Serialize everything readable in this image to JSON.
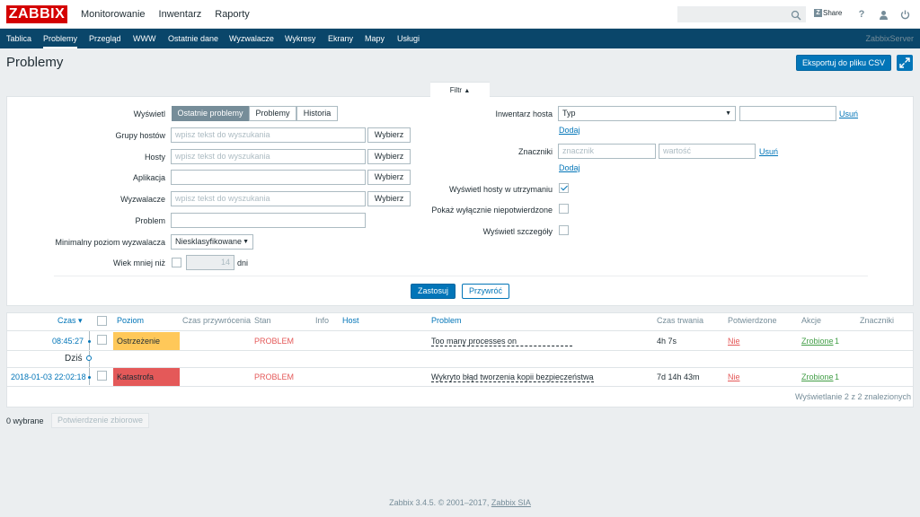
{
  "header": {
    "logo": "ZABBIX",
    "menu": [
      "Monitorowanie",
      "Inwentarz",
      "Raporty"
    ],
    "search_placeholder": "",
    "share": "Share",
    "help": "?"
  },
  "nav": {
    "items": [
      "Tablica",
      "Problemy",
      "Przegląd",
      "WWW",
      "Ostatnie dane",
      "Wyzwalacze",
      "Wykresy",
      "Ekrany",
      "Mapy",
      "Usługi"
    ],
    "active": "Problemy",
    "server": "ZabbixServer"
  },
  "page": {
    "title": "Problemy",
    "export_button": "Eksportuj do pliku CSV"
  },
  "filter": {
    "tab_label": "Filtr",
    "show_label": "Wyświetl",
    "show_options": [
      "Ostatnie problemy",
      "Problemy",
      "Historia"
    ],
    "show_selected": "Ostatnie problemy",
    "host_groups_label": "Grupy hostów",
    "hosts_label": "Hosty",
    "application_label": "Aplikacja",
    "triggers_label": "Wyzwalacze",
    "problem_label": "Problem",
    "min_severity_label": "Minimalny poziom wyzwalacza",
    "min_severity_value": "Niesklasyfikowane",
    "age_label": "Wiek mniej niż",
    "age_value": "14",
    "age_unit": "dni",
    "placeholder": "wpisz tekst do wyszukania",
    "select_button": "Wybierz",
    "inventory_label": "Inwentarz hosta",
    "inventory_field": "Typ",
    "remove_link": "Usuń",
    "add_link": "Dodaj",
    "tags_label": "Znaczniki",
    "tag_placeholder": "znacznik",
    "value_placeholder": "wartość",
    "maintenance_label": "Wyświetl hosty w utrzymaniu",
    "maintenance_checked": true,
    "unack_label": "Pokaż wyłącznie niepotwierdzone",
    "unack_checked": false,
    "details_label": "Wyświetl szczegóły",
    "details_checked": false,
    "apply_button": "Zastosuj",
    "reset_button": "Przywróć"
  },
  "table": {
    "headers": {
      "time": "Czas ▾",
      "severity": "Poziom",
      "recovery_time": "Czas przywrócenia",
      "status": "Stan",
      "info": "Info",
      "host": "Host",
      "problem": "Problem",
      "duration": "Czas trwania",
      "ack": "Potwierdzone",
      "actions": "Akcje",
      "tags": "Znaczniki"
    },
    "today_label": "Dziś",
    "rows": [
      {
        "time": "08:45:27",
        "severity": "Ostrzeżenie",
        "severity_color": "#ffc859",
        "status": "PROBLEM",
        "problem": "Too many processes on",
        "duration": "4h 7s",
        "ack": "Nie",
        "actions": "Zrobione",
        "actions_count": "1"
      },
      {
        "time": "2018-01-03 22:02:18",
        "severity": "Katastrofa",
        "severity_color": "#e45959",
        "status": "PROBLEM",
        "problem": "Wykryto błąd tworzenia kopii bezpieczeństwa",
        "duration": "7d 14h 43m",
        "ack": "Nie",
        "actions": "Zrobione",
        "actions_count": "1"
      }
    ],
    "footer": "Wyświetlanie 2 z 2 znalezionych"
  },
  "bottom": {
    "selected": "0 wybrane",
    "mass_ack_button": "Potwierdzenie zbiorowe"
  },
  "copyright": {
    "text": "Zabbix 3.4.5. © 2001–2017,",
    "company": "Zabbix SIA"
  },
  "colors": {
    "brand": "#d40000",
    "nav_bg": "#0a466a",
    "accent": "#0275b8",
    "problem": "#e45959",
    "ok_action": "#429e47"
  }
}
